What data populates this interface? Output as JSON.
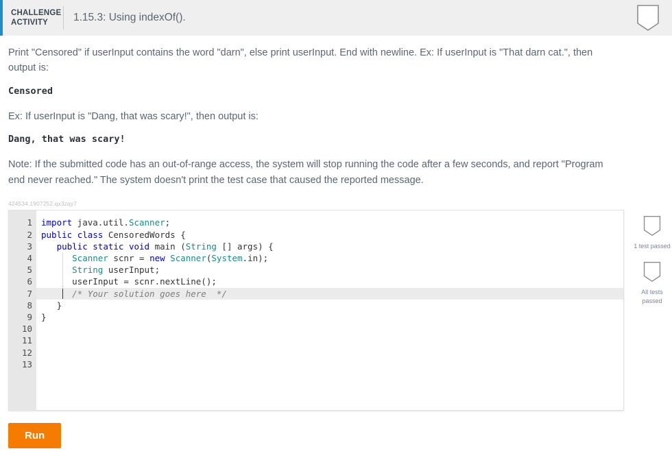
{
  "header": {
    "kicker_line1": "CHALLENGE",
    "kicker_line2": "ACTIVITY",
    "title": "1.15.3: Using indexOf().",
    "badge_icon": "shield-badge-icon",
    "accent_color": "#1b8ecb",
    "background": "#efefef"
  },
  "instructions": {
    "p1": "Print \"Censored\" if userInput contains the word \"darn\", else print userInput. End with newline. Ex: If userInput is \"That darn cat.\", then output is:",
    "out1": "Censored",
    "p2": "Ex: If userInput is \"Dang, that was scary!\", then output is:",
    "out2": "Dang, that was scary!",
    "p3": "Note: If the submitted code has an out-of-range access, the system will stop running the code after a few seconds, and report \"Program end never reached.\" The system doesn't print the test case that caused the reported message."
  },
  "editor": {
    "id_label": "424534.1907252.qx3zqy7",
    "active_line": 10,
    "line_numbers": [
      "1",
      "2",
      "3",
      "4",
      "5",
      "6",
      "7",
      "8",
      "9",
      "10",
      "11",
      "12",
      "13"
    ],
    "lines": [
      "import java.util.Scanner;",
      "",
      "public class CensoredWords {",
      "   public static void main (String [] args) {",
      "      Scanner scnr = new Scanner(System.in);",
      "      String userInput;",
      "",
      "      userInput = scnr.nextLine();",
      "",
      "      /* Your solution goes here  */",
      "",
      "   }",
      "}"
    ]
  },
  "tests": {
    "items": [
      {
        "icon": "shield-badge-icon",
        "label": "1 test passed"
      },
      {
        "icon": "shield-badge-icon",
        "label": "All tests passed"
      }
    ],
    "item0_label": "1 test passed",
    "item1_label": "All tests passed"
  },
  "actions": {
    "run_label": "Run",
    "run_color": "#f57c00"
  }
}
